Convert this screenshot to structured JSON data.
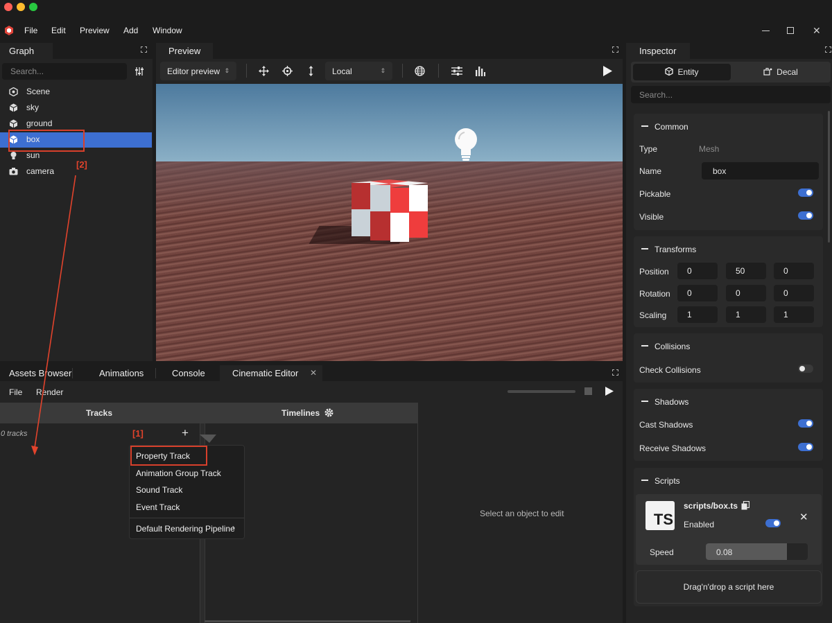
{
  "menu": [
    "File",
    "Edit",
    "Preview",
    "Add",
    "Window"
  ],
  "graph": {
    "title": "Graph",
    "search_placeholder": "Search...",
    "items": [
      "Scene",
      "sky",
      "ground",
      "box",
      "sun",
      "camera"
    ]
  },
  "preview": {
    "title": "Preview",
    "mode": "Editor preview",
    "space": "Local"
  },
  "inspector": {
    "title": "Inspector",
    "tabs": [
      "Entity",
      "Decal"
    ],
    "search_placeholder": "Search...",
    "common": {
      "title": "Common",
      "type_label": "Type",
      "type_value": "Mesh",
      "name_label": "Name",
      "name_value": "box",
      "pickable_label": "Pickable",
      "visible_label": "Visible"
    },
    "transforms": {
      "title": "Transforms",
      "position_label": "Position",
      "position": [
        "0",
        "50",
        "0"
      ],
      "rotation_label": "Rotation",
      "rotation": [
        "0",
        "0",
        "0"
      ],
      "scaling_label": "Scaling",
      "scaling": [
        "1",
        "1",
        "1"
      ]
    },
    "collisions": {
      "title": "Collisions",
      "check_label": "Check Collisions"
    },
    "shadows": {
      "title": "Shadows",
      "cast_label": "Cast Shadows",
      "receive_label": "Receive Shadows"
    },
    "scripts": {
      "title": "Scripts",
      "badge": "TS",
      "file": "scripts/box.ts",
      "enabled_label": "Enabled",
      "speed_label": "Speed",
      "speed_value": "0.08",
      "dropzone": "Drag'n'drop a script here"
    }
  },
  "bottom": {
    "tabs": [
      "Assets Browser",
      "Animations",
      "Console",
      "Cinematic Editor"
    ],
    "file_menu": "File",
    "render_menu": "Render",
    "tracks_header": "Tracks",
    "timelines_header": "Timelines",
    "tracks_count": "0 tracks",
    "dropdown": [
      "Property Track",
      "Animation Group Track",
      "Sound Track",
      "Event Track",
      "Default Rendering Pipeline"
    ],
    "empty_hint": "Select an object to edit"
  },
  "annotations": [
    "[1]",
    "[2]"
  ],
  "colors": {
    "accent": "#3d6fd1",
    "annotation": "#e2432c",
    "panel": "#242424",
    "background": "#1c1c1c"
  }
}
